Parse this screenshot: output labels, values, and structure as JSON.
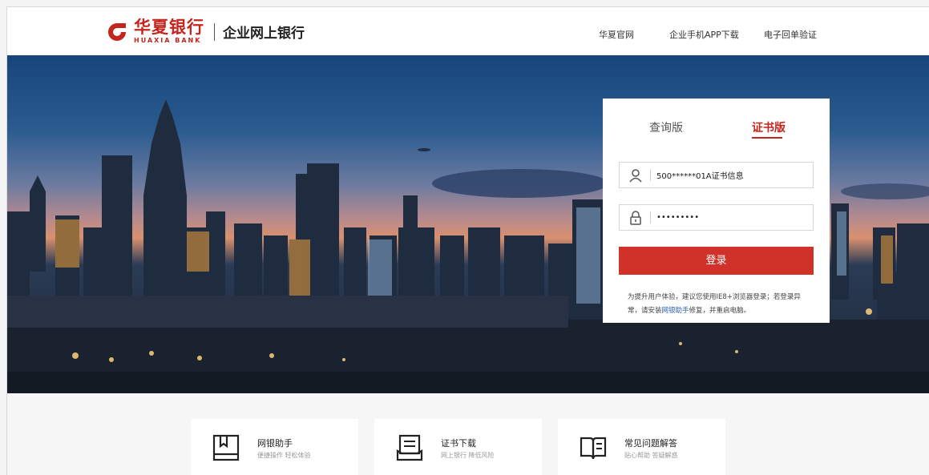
{
  "brand": {
    "name_cn": "华夏银行",
    "name_en": "HUAXIA BANK",
    "subtitle": "企业网上银行",
    "accent_color": "#c4251d"
  },
  "nav": [
    {
      "label": "华夏官网"
    },
    {
      "label": "企业手机APP下载"
    },
    {
      "label": "电子回单验证"
    }
  ],
  "login": {
    "tabs": [
      {
        "label": "查询版",
        "active": false
      },
      {
        "label": "证书版",
        "active": true
      }
    ],
    "username": {
      "value": "500******01A证书信息",
      "icon": "user-icon"
    },
    "password": {
      "value": "•••••••••",
      "icon": "lock-icon"
    },
    "submit_label": "登录",
    "tip_prefix": "为提升用户体验，建议您使用IE8+浏览器登录；若登录异常，请安装",
    "tip_link": "网银助手",
    "tip_suffix": "修复，并重启电脑。"
  },
  "cards": [
    {
      "title": "网银助手",
      "subtitle": "便捷操作 轻松体验",
      "icon": "bookmark-book-icon"
    },
    {
      "title": "证书下载",
      "subtitle": "网上银行 降低风险",
      "icon": "certificate-download-icon"
    },
    {
      "title": "常见问题解答",
      "subtitle": "贴心帮助 答疑解惑",
      "icon": "open-book-icon"
    }
  ]
}
